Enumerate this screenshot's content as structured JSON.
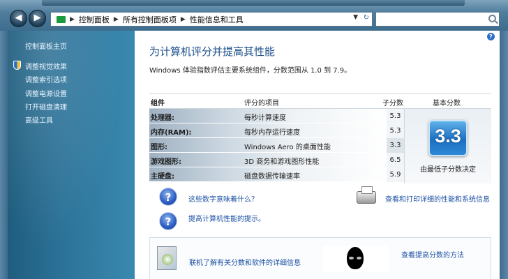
{
  "breadcrumb": [
    "控制面板",
    "所有控制面板项",
    "性能信息和工具"
  ],
  "sidebar": {
    "home": "控制面板主页",
    "items": [
      "调整视觉效果",
      "调整索引选项",
      "调整电源设置",
      "打开磁盘清理",
      "高级工具"
    ]
  },
  "main": {
    "heading": "为计算机评分并提高其性能",
    "subtitle": "Windows 体验指数评估主要系统组件，分数范围从 1.0 到 7.9。",
    "columns": [
      "组件",
      "评分的项目",
      "子分数",
      "基本分数"
    ],
    "rows": [
      {
        "component": "处理器:",
        "item": "每秒计算速度",
        "score": "5.3"
      },
      {
        "component": "内存(RAM):",
        "item": "每秒内存运行速度",
        "score": "5.3"
      },
      {
        "component": "图形:",
        "item": "Windows Aero 的桌面性能",
        "score": "3.3"
      },
      {
        "component": "游戏图形:",
        "item": "3D 商务和游戏图形性能",
        "score": "6.5"
      },
      {
        "component": "主硬盘:",
        "item": "磁盘数据传输速率",
        "score": "5.9"
      }
    ],
    "base_score": "3.3",
    "base_caption": "由最低子分数决定",
    "links": {
      "meaning": "这些数字意味着什么？",
      "tips": "提高计算机性能的提示。",
      "print": "查看和打印详细的性能和系统信息",
      "learn_more": "联机了解有关分数和软件的详细信息",
      "raise_score": "查看提高分数的方法"
    }
  },
  "icons": [
    "back-arrow-icon",
    "forward-arrow-icon",
    "folder-icon",
    "search-icon",
    "help-icon",
    "shield-icon",
    "question-icon",
    "printer-icon",
    "software-icon",
    "alien-logo-icon"
  ],
  "colors": {
    "link": "#1a4fa3",
    "heading": "#1b4f8a",
    "sidebar_bg": "#2b7197",
    "badge": "#1c6fc0"
  }
}
